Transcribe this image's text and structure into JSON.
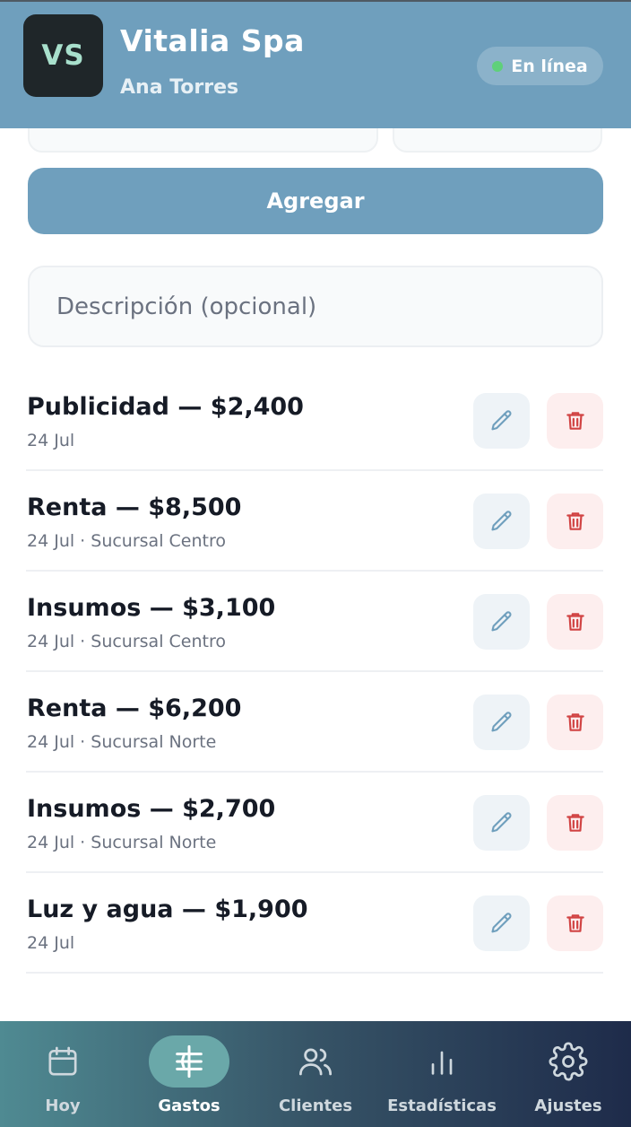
{
  "header": {
    "avatar_initials": "VS",
    "business_name": "Vitalia Spa",
    "user_name": "Ana Torres",
    "status_label": "En línea",
    "status_color": "#5fd07a",
    "background_color": "#6f9fbd"
  },
  "form": {
    "add_button_label": "Agregar",
    "description_placeholder": "Descripción (opcional)"
  },
  "expenses": [
    {
      "title": "Publicidad — $2,400",
      "subtitle": "24 Jul"
    },
    {
      "title": "Renta — $8,500",
      "subtitle": "24 Jul · Sucursal Centro"
    },
    {
      "title": "Insumos — $3,100",
      "subtitle": "24 Jul · Sucursal Centro"
    },
    {
      "title": "Renta — $6,200",
      "subtitle": "24 Jul · Sucursal Norte"
    },
    {
      "title": "Insumos — $2,700",
      "subtitle": "24 Jul · Sucursal Norte"
    },
    {
      "title": "Luz y agua — $1,900",
      "subtitle": "24 Jul"
    }
  ],
  "row_icons": {
    "edit": "pencil-icon",
    "delete": "trash-icon"
  },
  "nav": {
    "active": "Gastos",
    "items": [
      {
        "label": "Hoy",
        "icon": "calendar-icon"
      },
      {
        "label": "Gastos",
        "icon": "expenses-icon"
      },
      {
        "label": "Clientes",
        "icon": "users-icon"
      },
      {
        "label": "Estadísticas",
        "icon": "bar-chart-icon"
      },
      {
        "label": "Ajustes",
        "icon": "gear-icon"
      }
    ]
  }
}
